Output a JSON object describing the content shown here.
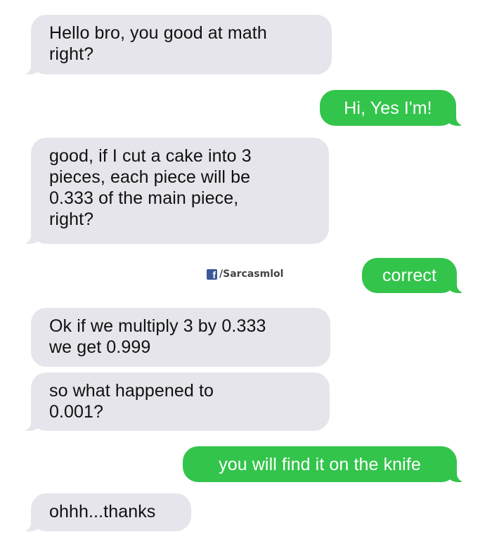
{
  "messages": [
    {
      "side": "in",
      "text": "Hello bro, you good at math\nright?"
    },
    {
      "side": "out",
      "text": "Hi, Yes I'm!"
    },
    {
      "side": "in",
      "text": "good, if I cut a cake into 3\npieces, each piece will be\n0.333 of the main piece,\nright?"
    },
    {
      "side": "out",
      "text": "correct"
    },
    {
      "side": "in",
      "text": "Ok if we multiply 3 by 0.333\nwe get 0.999"
    },
    {
      "side": "in",
      "text": "so what happened to\n0.001?"
    },
    {
      "side": "out",
      "text": "you will find it on the knife"
    },
    {
      "side": "in",
      "text": "ohhh...thanks"
    }
  ],
  "watermark": {
    "icon": "facebook-icon",
    "icon_letter": "f",
    "text": "/Sarcasmlol"
  },
  "colors": {
    "incoming_bubble": "#e6e5eb",
    "outgoing_bubble": "#33c44b",
    "background": "#ffffff"
  }
}
